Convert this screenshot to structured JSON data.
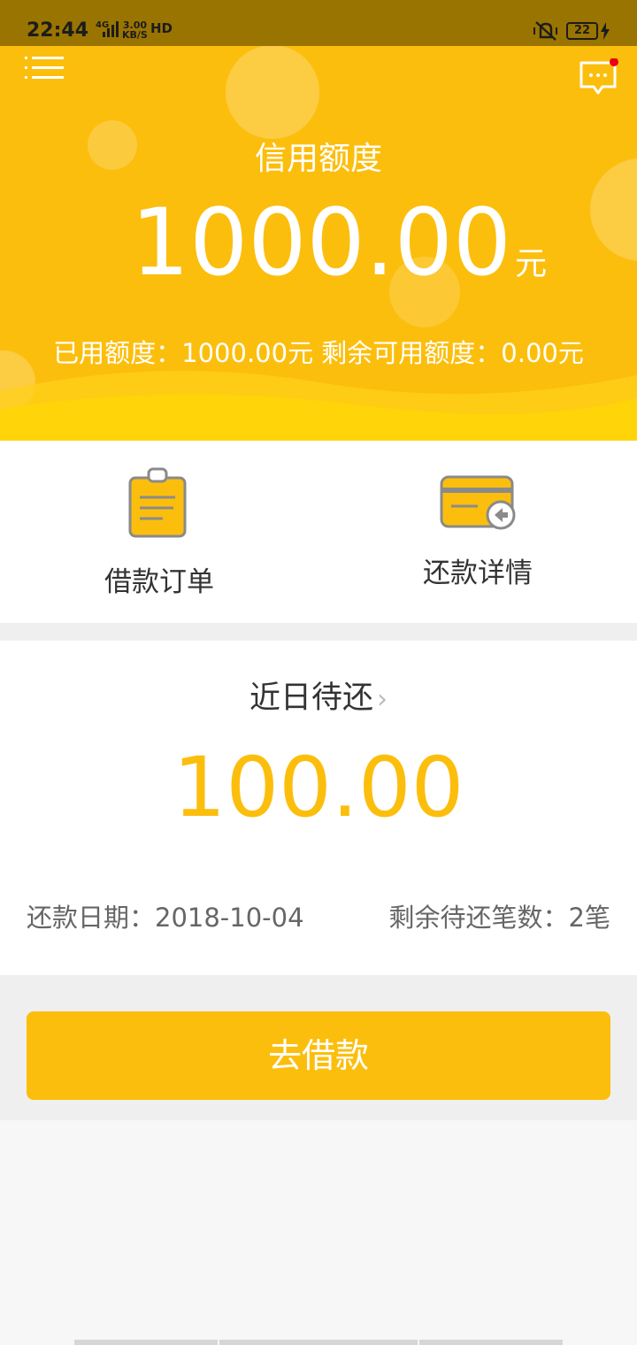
{
  "status_bar": {
    "time": "22:44",
    "network": "4G",
    "speed_value": "3.00",
    "speed_unit": "KB/S",
    "hd": "HD",
    "battery": "22"
  },
  "hero": {
    "title": "信用额度",
    "amount": "1000.00",
    "unit": "元",
    "summary": "已用额度：1000.00元 剩余可用额度：0.00元",
    "notification_dot_color": "#e60012"
  },
  "actions": [
    {
      "label": "借款订单",
      "icon": "clipboard-icon"
    },
    {
      "label": "还款详情",
      "icon": "card-return-icon"
    }
  ],
  "upcoming": {
    "title": "近日待还",
    "amount": "100.00",
    "date": "还款日期：2018-10-04",
    "count": "剩余待还笔数：2笔"
  },
  "borrow_button": "去借款",
  "colors": {
    "accent": "#fcbe0d",
    "status_bar": "#9a7400"
  }
}
